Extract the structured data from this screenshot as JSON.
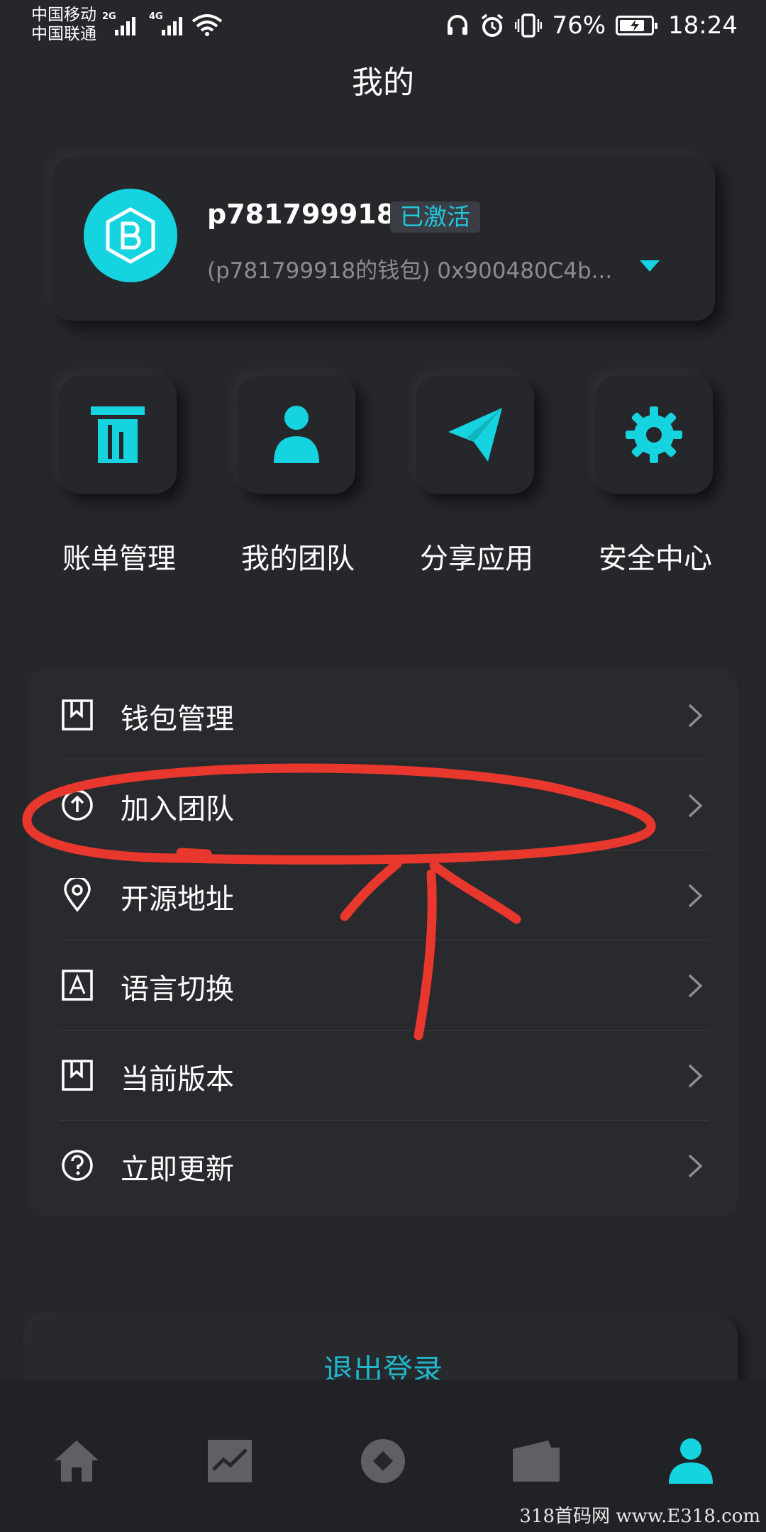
{
  "status_bar": {
    "carrier_1": "中国移动",
    "carrier_2": "中国联通",
    "network_1": "2G",
    "network_2": "4G",
    "battery_percent": "76%",
    "time": "18:24",
    "icons": [
      "signal-icon",
      "wifi-icon",
      "headphones-icon",
      "alarm-icon",
      "vibrate-icon",
      "battery-charging-icon"
    ]
  },
  "page": {
    "title": "我的"
  },
  "profile": {
    "username": "p781799918",
    "status_badge": "已激活",
    "wallet_line": "(p781799918的钱包) 0x900480C4b...",
    "avatar_icon": "wallet-logo-icon",
    "accent": "#16d3e0"
  },
  "quick_actions": [
    {
      "label": "账单管理",
      "icon": "bill-icon"
    },
    {
      "label": "我的团队",
      "icon": "team-icon"
    },
    {
      "label": "分享应用",
      "icon": "share-icon"
    },
    {
      "label": "安全中心",
      "icon": "security-gear-icon"
    }
  ],
  "menu": [
    {
      "label": "钱包管理",
      "icon": "bookmark-icon"
    },
    {
      "label": "加入团队",
      "icon": "upload-circle-icon"
    },
    {
      "label": "开源地址",
      "icon": "location-pin-icon"
    },
    {
      "label": "语言切换",
      "icon": "language-icon"
    },
    {
      "label": "当前版本",
      "icon": "bookmark-icon"
    },
    {
      "label": "立即更新",
      "icon": "help-circle-icon"
    }
  ],
  "logout": {
    "label": "退出登录",
    "color": "#1fb7c9"
  },
  "bottom_nav": [
    {
      "icon": "home-icon",
      "active": false
    },
    {
      "icon": "chart-icon",
      "active": false
    },
    {
      "icon": "discover-icon",
      "active": false
    },
    {
      "icon": "wallet-icon",
      "active": false
    },
    {
      "icon": "profile-icon",
      "active": true
    }
  ],
  "colors": {
    "accent": "#1fc9dc",
    "inactive_nav": "#5f6066",
    "annotation": "#e8372c"
  },
  "watermark": "318首码网 www.E318.com"
}
